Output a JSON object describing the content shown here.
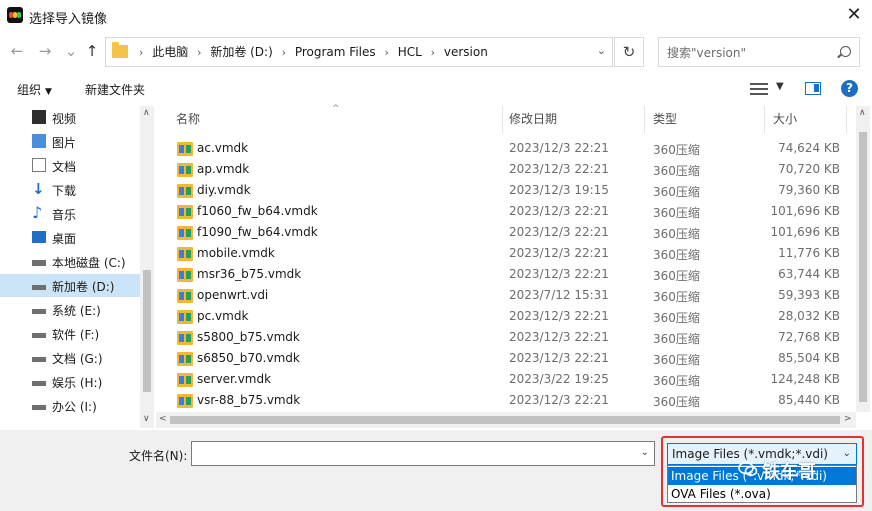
{
  "window": {
    "title": "选择导入镜像",
    "close_symbol": "✕"
  },
  "nav": {
    "back": "←",
    "forward": "→",
    "recent": "⌄",
    "up": "↑",
    "refresh": "↻",
    "address_dropdown": "⌄"
  },
  "breadcrumbs": [
    "此电脑",
    "新加卷 (D:)",
    "Program Files",
    "HCL",
    "version"
  ],
  "breadcrumb_sep": "›",
  "search": {
    "placeholder": "搜索\"version\""
  },
  "toolbar": {
    "organize": "组织",
    "organize_caret": "▼",
    "new_folder": "新建文件夹",
    "view_caret": "▼",
    "help": "?"
  },
  "sidebar": {
    "items": [
      {
        "label": "视频",
        "icon": "video-icon",
        "color": "#2d2d2d"
      },
      {
        "label": "图片",
        "icon": "pictures-icon",
        "color": "#4a90d9"
      },
      {
        "label": "文档",
        "icon": "documents-icon",
        "color": "#7a7a7a"
      },
      {
        "label": "下载",
        "icon": "download-icon",
        "color": "#1f6fc5"
      },
      {
        "label": "音乐",
        "icon": "music-icon",
        "color": "#1f6fc5"
      },
      {
        "label": "桌面",
        "icon": "desktop-icon",
        "color": "#1f6fc5"
      },
      {
        "label": "本地磁盘 (C:)",
        "icon": "drive-c-icon",
        "color": "#6f6f6f"
      },
      {
        "label": "新加卷 (D:)",
        "icon": "drive-icon",
        "color": "#6f6f6f",
        "selected": true
      },
      {
        "label": "系统 (E:)",
        "icon": "drive-icon",
        "color": "#6f6f6f"
      },
      {
        "label": "软件 (F:)",
        "icon": "drive-icon",
        "color": "#6f6f6f"
      },
      {
        "label": "文档 (G:)",
        "icon": "drive-icon",
        "color": "#6f6f6f"
      },
      {
        "label": "娱乐 (H:)",
        "icon": "drive-icon",
        "color": "#6f6f6f"
      },
      {
        "label": "办公 (I:)",
        "icon": "drive-icon",
        "color": "#6f6f6f"
      }
    ]
  },
  "columns": {
    "name": "名称",
    "date": "修改日期",
    "type": "类型",
    "size": "大小",
    "sort_indicator": "^"
  },
  "files": [
    {
      "name": "ac.vmdk",
      "date": "2023/12/3 22:21",
      "type": "360压缩",
      "size": "74,624 KB"
    },
    {
      "name": "ap.vmdk",
      "date": "2023/12/3 22:21",
      "type": "360压缩",
      "size": "70,720 KB"
    },
    {
      "name": "diy.vmdk",
      "date": "2023/12/3 19:15",
      "type": "360压缩",
      "size": "79,360 KB"
    },
    {
      "name": "f1060_fw_b64.vmdk",
      "date": "2023/12/3 22:21",
      "type": "360压缩",
      "size": "101,696 KB"
    },
    {
      "name": "f1090_fw_b64.vmdk",
      "date": "2023/12/3 22:21",
      "type": "360压缩",
      "size": "101,696 KB"
    },
    {
      "name": "mobile.vmdk",
      "date": "2023/12/3 22:21",
      "type": "360压缩",
      "size": "11,776 KB"
    },
    {
      "name": "msr36_b75.vmdk",
      "date": "2023/12/3 22:21",
      "type": "360压缩",
      "size": "63,744 KB"
    },
    {
      "name": "openwrt.vdi",
      "date": "2023/7/12 15:31",
      "type": "360压缩",
      "size": "59,393 KB"
    },
    {
      "name": "pc.vmdk",
      "date": "2023/12/3 22:21",
      "type": "360压缩",
      "size": "28,032 KB"
    },
    {
      "name": "s5800_b75.vmdk",
      "date": "2023/12/3 22:21",
      "type": "360压缩",
      "size": "72,768 KB"
    },
    {
      "name": "s6850_b70.vmdk",
      "date": "2023/12/3 22:21",
      "type": "360压缩",
      "size": "85,504 KB"
    },
    {
      "name": "server.vmdk",
      "date": "2023/3/22 19:25",
      "type": "360压缩",
      "size": "124,248 KB"
    },
    {
      "name": "vsr-88_b75.vmdk",
      "date": "2023/12/3 22:21",
      "type": "360压缩",
      "size": "85,440 KB"
    }
  ],
  "scroll": {
    "up": "∧",
    "down": "∨",
    "left": "<",
    "right": ">"
  },
  "filename": {
    "label": "文件名(N):",
    "value": "",
    "dropdown": "⌄"
  },
  "filetype": {
    "selected": "Image Files (*.vmdk;*.vdi)",
    "caret": "⌄",
    "options": [
      "Image Files (*.vmdk;*.vdi)",
      "OVA Files (*.ova)"
    ]
  },
  "watermark": {
    "text": "铁车哥"
  },
  "colors": {
    "accent": "#0078d7",
    "highlight_box": "#e3322f",
    "selection": "#cce4f7"
  }
}
